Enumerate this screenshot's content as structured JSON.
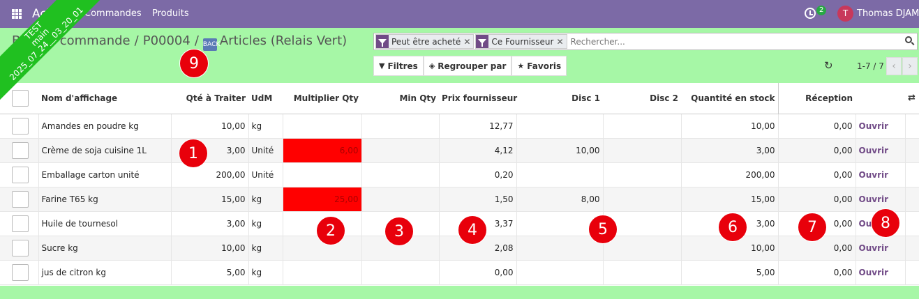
{
  "navbar": {
    "app_name": "Achats",
    "menu": [
      "Commandes",
      "Produits"
    ],
    "activity_count": "2",
    "user_initial": "T",
    "user_name": "Thomas DJAMA"
  },
  "ribbon": {
    "line1": "TEST",
    "line2": "main",
    "line3": "2025_07_24__03_20_01"
  },
  "breadcrumb": {
    "items": [
      "Bon de commande",
      "P00004"
    ],
    "current": "Articles (Relais Vert)",
    "back_icon_text": "BACK"
  },
  "search": {
    "facets": [
      {
        "label": "Peut être acheté",
        "icon": "filter-icon"
      },
      {
        "label": "Ce Fournisseur",
        "icon": "filter-icon"
      }
    ],
    "placeholder": "Rechercher..."
  },
  "toolbar": {
    "filters": "Filtres",
    "group_by": "Regrouper par",
    "favorites": "Favoris"
  },
  "pager": {
    "value": "1-7 / 7",
    "prev": "‹",
    "next": "›"
  },
  "table": {
    "columns": [
      "Nom d'affichage",
      "Qté à Traiter",
      "UdM",
      "Multiplier Qty",
      "Min Qty",
      "Prix fournisseur",
      "Disc 1",
      "Disc 2",
      "Quantité en stock",
      "Réception"
    ],
    "open_label": "Ouvrir",
    "rows": [
      {
        "name": "Amandes en poudre kg",
        "qty": "10,00",
        "uom": "kg",
        "mult": "",
        "mult_alert": false,
        "min": "",
        "price": "12,77",
        "disc1": "",
        "disc2": "",
        "stock": "10,00",
        "reception": "0,00"
      },
      {
        "name": "Crème de soja cuisine 1L",
        "qty": "3,00",
        "uom": "Unité",
        "mult": "6,00",
        "mult_alert": true,
        "min": "",
        "price": "4,12",
        "disc1": "10,00",
        "disc2": "",
        "stock": "3,00",
        "reception": "0,00"
      },
      {
        "name": "Emballage carton unité",
        "qty": "200,00",
        "uom": "Unité",
        "mult": "",
        "mult_alert": false,
        "min": "",
        "price": "0,20",
        "disc1": "",
        "disc2": "",
        "stock": "200,00",
        "reception": "0,00"
      },
      {
        "name": "Farine T65 kg",
        "qty": "15,00",
        "uom": "kg",
        "mult": "25,00",
        "mult_alert": true,
        "min": "",
        "price": "1,50",
        "disc1": "8,00",
        "disc2": "",
        "stock": "15,00",
        "reception": "0,00"
      },
      {
        "name": "Huile de tournesol",
        "qty": "3,00",
        "uom": "kg",
        "mult": "",
        "mult_alert": false,
        "min": "",
        "price": "3,37",
        "disc1": "",
        "disc2": "",
        "stock": "3,00",
        "reception": "0,00"
      },
      {
        "name": "Sucre kg",
        "qty": "10,00",
        "uom": "kg",
        "mult": "",
        "mult_alert": false,
        "min": "",
        "price": "2,08",
        "disc1": "",
        "disc2": "",
        "stock": "10,00",
        "reception": "0,00"
      },
      {
        "name": "jus de citron kg",
        "qty": "5,00",
        "uom": "kg",
        "mult": "",
        "mult_alert": false,
        "min": "",
        "price": "0,00",
        "disc1": "",
        "disc2": "",
        "stock": "5,00",
        "reception": "0,00"
      }
    ]
  },
  "markers": [
    "1",
    "2",
    "3",
    "4",
    "5",
    "6",
    "7",
    "8",
    "9"
  ],
  "colors": {
    "navbar": "#7c6aa6",
    "background": "#a6f7a6",
    "alert": "#ff0000",
    "marker": "#e8000b",
    "ribbon": "#20c020"
  }
}
